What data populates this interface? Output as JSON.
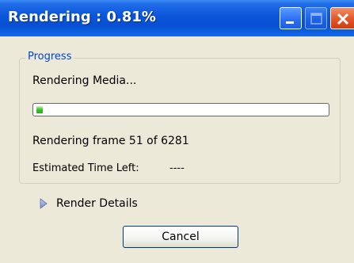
{
  "window": {
    "title": "Rendering : 0.81%",
    "controls": {
      "minimize": "minimize-icon",
      "maximize": "maximize-icon",
      "close": "close-icon"
    }
  },
  "progress_group": {
    "legend": "Progress",
    "status": "Rendering Media...",
    "progress_fraction": 0.0081,
    "frame_status": "Rendering frame 51 of 6281",
    "eta_label": "Estimated Time Left:",
    "eta_value": "----"
  },
  "details": {
    "label": "Render Details",
    "icon": "expand-arrow-icon"
  },
  "buttons": {
    "cancel": "Cancel"
  },
  "colors": {
    "title_bar": "#0a55d9",
    "legend_text": "#0046d5",
    "progress_fill": "#41c52e",
    "close_button": "#e35a2c"
  }
}
